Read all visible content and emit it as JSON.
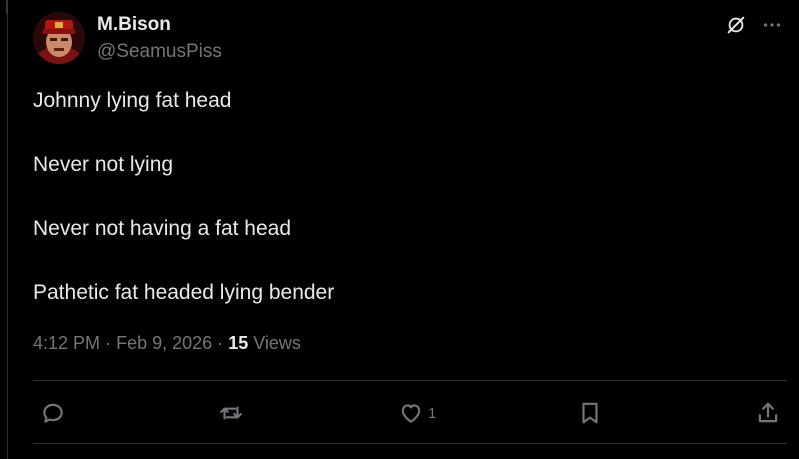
{
  "post": {
    "display_name": "M.Bison",
    "handle": "@SeamusPiss",
    "paragraphs": [
      "Johnny lying fat head",
      "Never not lying",
      "Never not having a fat head",
      "Pathetic fat headed lying bender"
    ],
    "time": "4:12 PM",
    "separator": "·",
    "date": "Feb 9, 2026",
    "views_count": "15",
    "views_label": "Views"
  },
  "actions": {
    "reply_count": "",
    "repost_count": "",
    "like_count": "1"
  },
  "icons": {
    "grok": "grok-icon",
    "more": "more-icon",
    "reply": "reply-icon",
    "repost": "repost-icon",
    "like": "heart-icon",
    "bookmark": "bookmark-icon",
    "share": "share-icon"
  },
  "colors": {
    "background": "#000000",
    "primary_text": "#e7e9ea",
    "secondary_text": "#71767b",
    "border": "#2f3336"
  }
}
